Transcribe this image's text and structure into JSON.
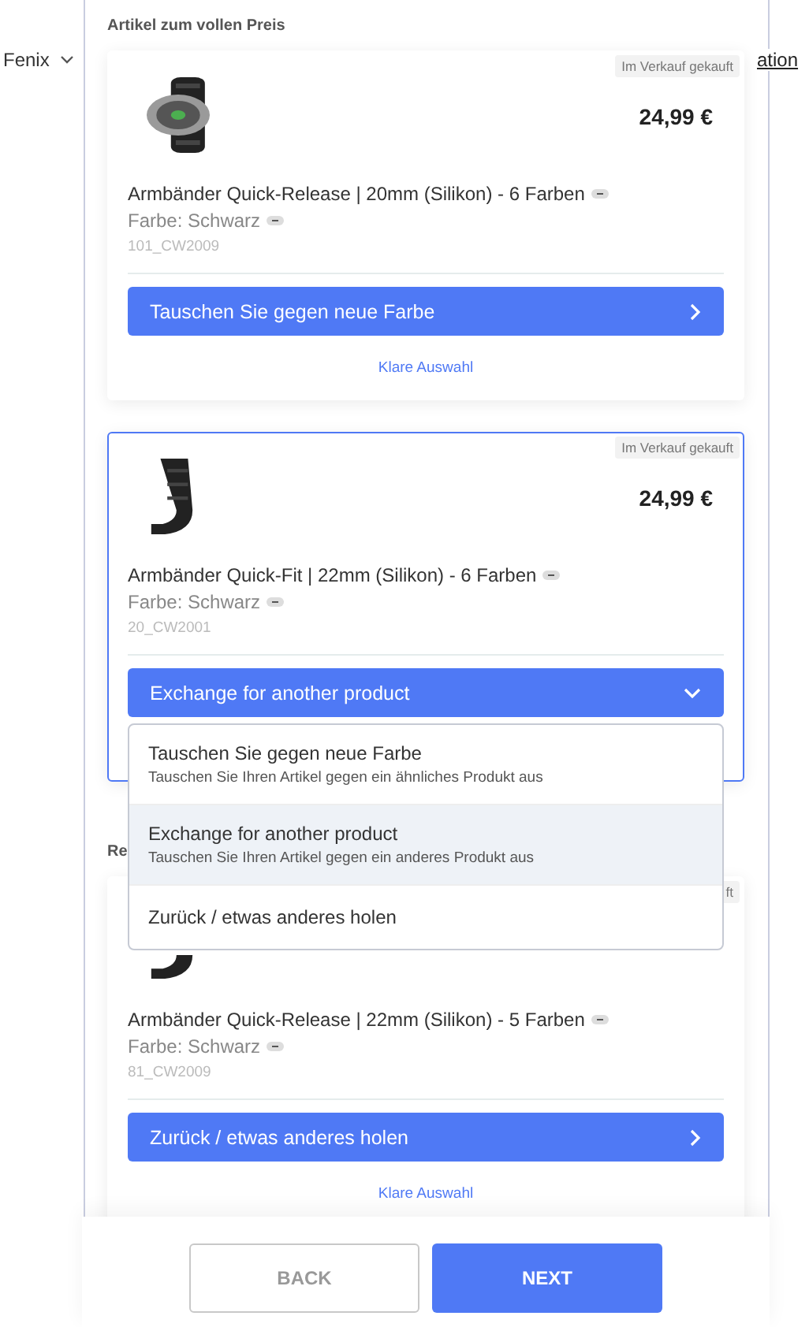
{
  "side_nav": {
    "label": "Fenix"
  },
  "right_link": "ation",
  "sections": [
    {
      "heading": "Artikel zum vollen Preis",
      "items": [
        {
          "badge": "Im Verkauf gekauft",
          "price": "24,99 €",
          "name": "Armbänder Quick-Release | 20mm (Silikon) - 6 Farben",
          "color_label": "Farbe: Schwarz",
          "sku": "101_CW2009",
          "selected": false,
          "action": {
            "label": "Tauschen Sie gegen neue Farbe",
            "expanded": false
          },
          "clear_link": "Klare Auswahl"
        },
        {
          "badge": "Im Verkauf gekauft",
          "price": "24,99 €",
          "name": "Armbänder Quick-Fit | 22mm (Silikon) - 6 Farben",
          "color_label": "Farbe: Schwarz",
          "sku": "20_CW2001",
          "selected": true,
          "action": {
            "label": "Exchange for another product",
            "expanded": true,
            "options": [
              {
                "title": "Tauschen Sie gegen neue Farbe",
                "description": "Tauschen Sie Ihren Artikel gegen ein ähnliches Produkt aus",
                "selected": false
              },
              {
                "title": "Exchange for another product",
                "description": "Tauschen Sie Ihren Artikel gegen ein anderes Produkt aus",
                "selected": true
              },
              {
                "title": "Zurück / etwas anderes holen",
                "selected": false
              }
            ]
          }
        }
      ]
    },
    {
      "heading": "Re",
      "items": [
        {
          "badge": "ft",
          "name": "Armbänder Quick-Release | 22mm (Silikon) - 5 Farben",
          "color_label": "Farbe: Schwarz",
          "sku": "81_CW2009",
          "selected": false,
          "action": {
            "label": "Zurück / etwas anderes holen",
            "expanded": false
          },
          "clear_link": "Klare Auswahl"
        }
      ]
    }
  ],
  "footer": {
    "buttons": [
      {
        "label": "BACK",
        "kind": "secondary"
      },
      {
        "label": "NEXT",
        "kind": "primary"
      }
    ]
  }
}
